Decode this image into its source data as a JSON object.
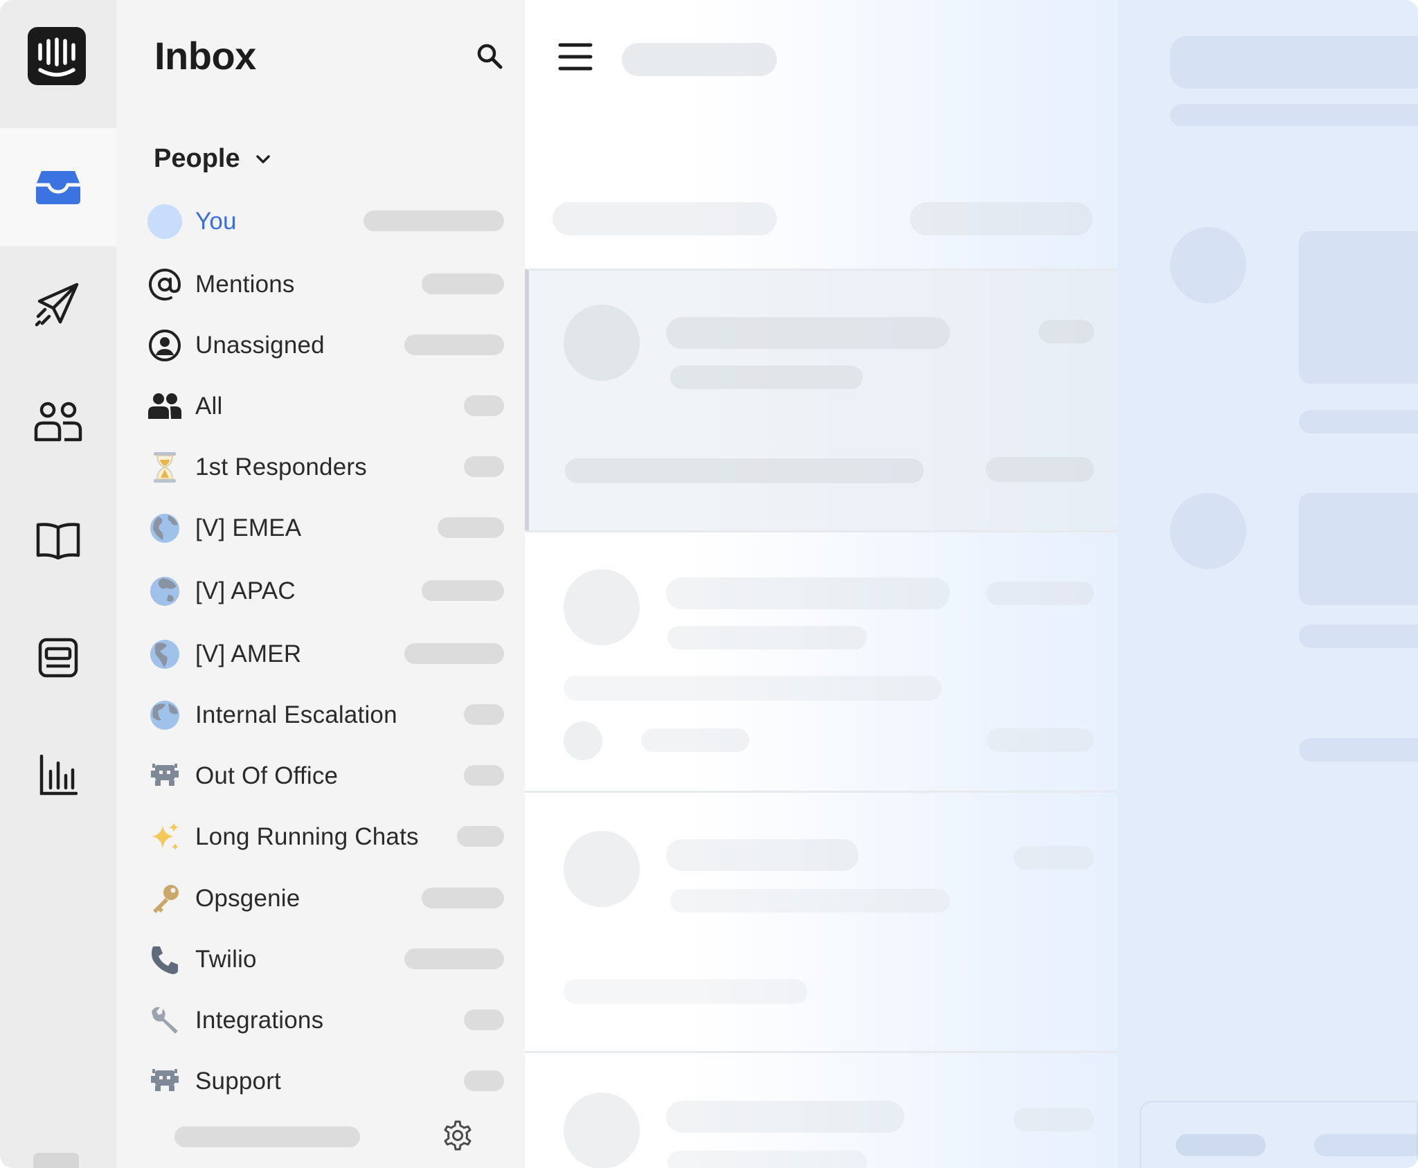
{
  "rail": {
    "items": [
      {
        "name": "inbox-icon",
        "active": true
      },
      {
        "name": "paper-plane-icon",
        "active": false
      },
      {
        "name": "people-icon",
        "active": false
      },
      {
        "name": "book-icon",
        "active": false
      },
      {
        "name": "note-icon",
        "active": false
      },
      {
        "name": "bar-chart-icon",
        "active": false
      }
    ],
    "accent": "#3b74e0"
  },
  "panel": {
    "title": "Inbox",
    "section_label": "People",
    "items": [
      {
        "label": "You",
        "icon": "avatar-icon",
        "selected": true
      },
      {
        "label": "Mentions",
        "icon": "at-sign-icon"
      },
      {
        "label": "Unassigned",
        "icon": "user-circle-icon"
      },
      {
        "label": "All",
        "icon": "group-icon"
      },
      {
        "label": "1st Responders",
        "icon": "hourglass-icon"
      },
      {
        "label": "[V] EMEA",
        "icon": "globe-icon"
      },
      {
        "label": "[V] APAC",
        "icon": "globe-icon"
      },
      {
        "label": "[V] AMER",
        "icon": "globe-icon"
      },
      {
        "label": "Internal Escalation",
        "icon": "globe-icon"
      },
      {
        "label": "Out Of Office",
        "icon": "alien-icon"
      },
      {
        "label": "Long Running Chats",
        "icon": "sparkles-icon"
      },
      {
        "label": "Opsgenie",
        "icon": "key-icon"
      },
      {
        "label": "Twilio",
        "icon": "phone-icon"
      },
      {
        "label": "Integrations",
        "icon": "wrench-icon"
      },
      {
        "label": "Support",
        "icon": "alien-icon"
      }
    ],
    "selected_color": "#3b6fd9"
  }
}
